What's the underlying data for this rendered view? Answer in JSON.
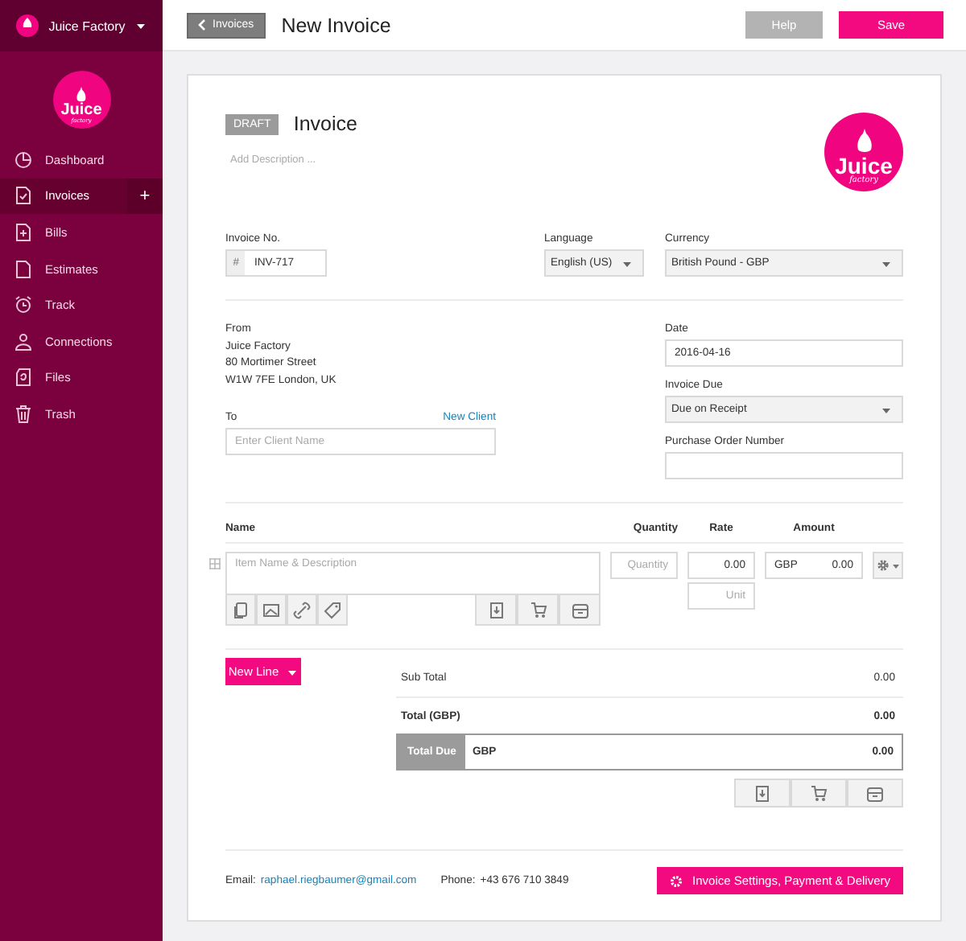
{
  "app": {
    "name": "Juice Factory"
  },
  "sidebar": {
    "logo": {
      "name": "Juice",
      "tagline": "factory"
    },
    "items": [
      {
        "label": "Dashboard",
        "selected": false
      },
      {
        "label": "Invoices",
        "selected": true
      },
      {
        "label": "Bills",
        "selected": false
      },
      {
        "label": "Estimates",
        "selected": false
      },
      {
        "label": "Track",
        "selected": false
      },
      {
        "label": "Connections",
        "selected": false
      },
      {
        "label": "Files",
        "selected": false
      },
      {
        "label": "Trash",
        "selected": false
      }
    ],
    "add_button": "+"
  },
  "toolbar": {
    "back_button": "Invoices",
    "title": "New Invoice",
    "buttons": [
      {
        "label": "Help",
        "kind": "secondary"
      },
      {
        "label": "Save",
        "kind": "primary"
      }
    ]
  },
  "invoice": {
    "status": "DRAFT",
    "title": "Invoice",
    "description_placeholder": "Add Description ...",
    "logo": {
      "name": "Juice",
      "tagline": "factory"
    },
    "number": {
      "label": "Invoice No.",
      "prefix": "#",
      "value": "INV-717"
    },
    "language": {
      "label": "Language",
      "value": "English (US)"
    },
    "currency": {
      "label": "Currency",
      "value": "British Pound - GBP"
    },
    "from": {
      "label": "From",
      "lines": [
        "Juice Factory",
        "80 Mortimer Street",
        "W1W 7FE London, UK"
      ]
    },
    "to": {
      "label": "To",
      "link": "New Client",
      "placeholder": "Enter Client Name"
    },
    "date": {
      "label": "Date",
      "value": "2016-04-16"
    },
    "due": {
      "label": "Invoice Due",
      "value": "Due on Receipt"
    },
    "po": {
      "label": "Purchase Order Number"
    },
    "items": {
      "columns": [
        "Name",
        "Quantity",
        "Rate",
        "Amount"
      ],
      "rows": [
        {
          "name_placeholder": "Item Name & Description",
          "quantity_placeholder": "Quantity",
          "rate": "0.00",
          "unit_placeholder": "Unit",
          "currency": "GBP",
          "amount": "0.00"
        }
      ]
    },
    "new_line": "New Line",
    "totals": {
      "subtotal": {
        "label": "Sub Total",
        "value": "0.00"
      },
      "total": {
        "label": "Total (GBP)",
        "value": "0.00"
      },
      "due": {
        "label": "Total Due",
        "currency": "GBP",
        "value": "0.00"
      }
    },
    "footer": {
      "email_label": "Email:",
      "email": "raphael.riegbaumer@gmail.com",
      "phone_label": "Phone:",
      "phone": "+43 676 710 3849",
      "settings_button": "Invoice Settings, Payment & Delivery"
    }
  }
}
